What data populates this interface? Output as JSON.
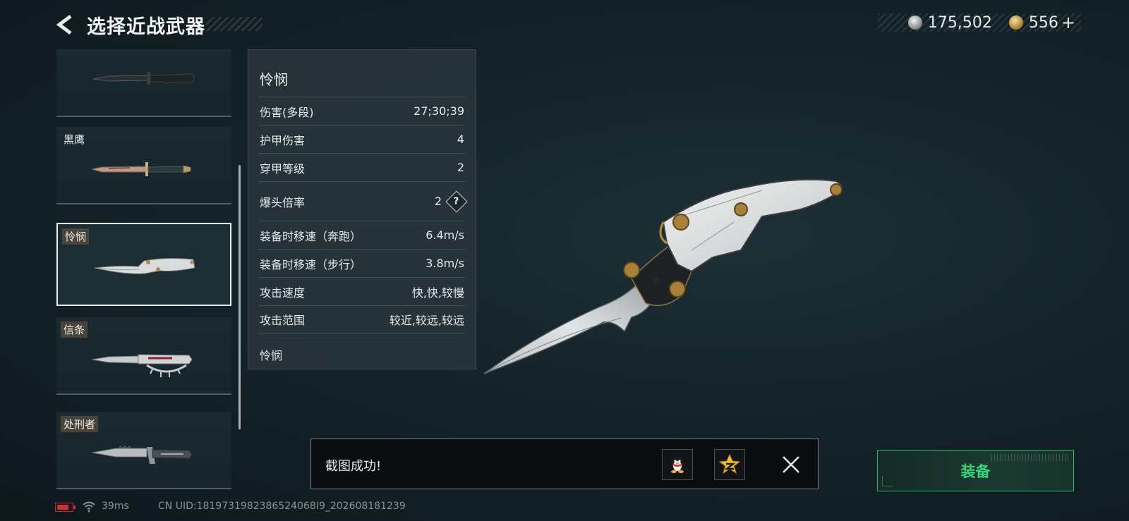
{
  "header": {
    "title": "选择近战武器"
  },
  "currency": {
    "silver_value": "175,502",
    "gold_value": "556",
    "plus_label": "+"
  },
  "weapon_list": [
    {
      "name": ""
    },
    {
      "name": "黑鹰"
    },
    {
      "name": "怜悯",
      "selected": true
    },
    {
      "name": "信条"
    },
    {
      "name": "处刑者"
    }
  ],
  "stats": {
    "title": "怜悯",
    "rows": [
      {
        "label": "伤害(多段)",
        "value": "27;30;39"
      },
      {
        "label": "护甲伤害",
        "value": "4"
      },
      {
        "label": "穿甲等级",
        "value": "2"
      },
      {
        "label": "爆头倍率",
        "value": "2"
      },
      {
        "label": "装备时移速（奔跑）",
        "value": "6.4m/s"
      },
      {
        "label": "装备时移速（步行）",
        "value": "3.8m/s"
      },
      {
        "label": "攻击速度",
        "value": "快,快,较慢"
      },
      {
        "label": "攻击范围",
        "value": "较近,较远,较远"
      }
    ],
    "help_symbol": "?",
    "description": "怜悯"
  },
  "toast": {
    "message": "截图成功!",
    "share_icons": [
      "qq-icon",
      "qzone-icon"
    ]
  },
  "equip": {
    "label": "装备",
    "accent_color": "#34d879"
  },
  "footer": {
    "ping": "39ms",
    "uid": "CN UID:1819731982386524068I9_202608181239"
  }
}
